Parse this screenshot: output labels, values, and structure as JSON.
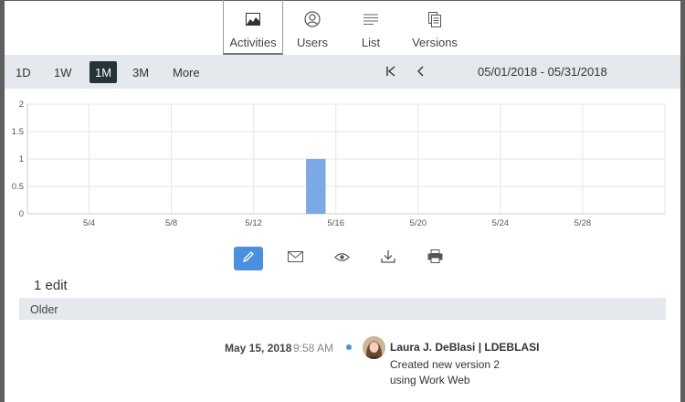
{
  "tabs": [
    {
      "label": "Activities",
      "icon": "activities-chart-icon",
      "active": true
    },
    {
      "label": "Users",
      "icon": "user-circle-icon"
    },
    {
      "label": "List",
      "icon": "list-icon"
    },
    {
      "label": "Versions",
      "icon": "versions-document-icon"
    }
  ],
  "toolbar": {
    "ranges": [
      {
        "label": "1D"
      },
      {
        "label": "1W"
      },
      {
        "label": "1M",
        "active": true
      },
      {
        "label": "3M"
      },
      {
        "label": "More"
      }
    ],
    "date_range": "05/01/2018 - 05/31/2018"
  },
  "chart_data": {
    "type": "bar",
    "title": "",
    "xlabel": "",
    "ylabel": "",
    "ylim": [
      0,
      2
    ],
    "y_ticks": [
      "0",
      "0.5",
      "1",
      "1.5",
      "2"
    ],
    "x_ticks": [
      "5/4",
      "5/8",
      "5/12",
      "5/16",
      "5/20",
      "5/24",
      "5/28"
    ],
    "x_range": [
      "05/01/2018",
      "05/31/2018"
    ],
    "bars": [
      {
        "x": "5/15",
        "value": 1
      }
    ],
    "grid": true,
    "bar_color": "#7aa9e6"
  },
  "actions": [
    {
      "name": "edit-icon",
      "active": true
    },
    {
      "name": "mail-icon"
    },
    {
      "name": "eye-icon"
    },
    {
      "name": "download-icon"
    },
    {
      "name": "print-icon"
    }
  ],
  "summary": {
    "count_text": "1 edit"
  },
  "section": {
    "label": "Older"
  },
  "entry": {
    "date": "May 15, 2018",
    "time": "9:58 AM",
    "user": "Laura J. DeBlasi | LDEBLASI",
    "line1": "Created new version 2",
    "line2": "using Work Web"
  },
  "colors": {
    "accent": "#4a90e2",
    "toolbar_bg": "#e5e8ec",
    "active_range_bg": "#243438"
  }
}
